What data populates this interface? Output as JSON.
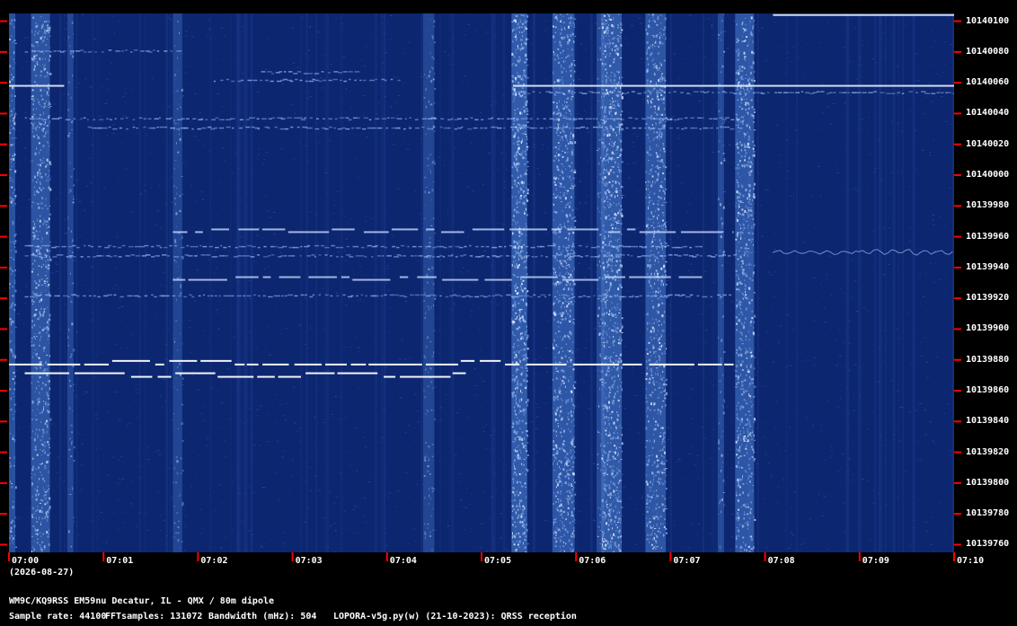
{
  "chart_data": {
    "type": "heatmap",
    "title": "",
    "x_ticks": [
      "07:00",
      "07:01",
      "07:02",
      "07:03",
      "07:04",
      "07:05",
      "07:06",
      "07:07",
      "07:08",
      "07:09",
      "07:10"
    ],
    "x_range": [
      "07:00",
      "07:10"
    ],
    "y_ticks": [
      10140100,
      10140080,
      10140060,
      10140040,
      10140020,
      10140000,
      10139980,
      10139960,
      10139940,
      10139920,
      10139900,
      10139880,
      10139860,
      10139840,
      10139820,
      10139800,
      10139780,
      10139760
    ],
    "y_range": [
      10139755,
      10140105
    ],
    "colors": {
      "background": "#000000",
      "waterfall": "#0c2670",
      "tick": "#ff0000",
      "trace": "#ffffff"
    },
    "noise_columns": [
      {
        "start": "07:00:00",
        "end": "07:00:04",
        "intensity": 0.6
      },
      {
        "start": "07:00:14",
        "end": "07:00:26",
        "intensity": 0.7
      },
      {
        "start": "07:00:37",
        "end": "07:00:41",
        "intensity": 0.25
      },
      {
        "start": "07:01:44",
        "end": "07:01:50",
        "intensity": 0.2
      },
      {
        "start": "07:04:23",
        "end": "07:04:30",
        "intensity": 0.25
      },
      {
        "start": "07:05:19",
        "end": "07:05:29",
        "intensity": 0.95
      },
      {
        "start": "07:05:45",
        "end": "07:05:59",
        "intensity": 0.8
      },
      {
        "start": "07:06:13",
        "end": "07:06:18",
        "intensity": 0.35
      },
      {
        "start": "07:06:16",
        "end": "07:06:29",
        "intensity": 0.9
      },
      {
        "start": "07:06:44",
        "end": "07:06:57",
        "intensity": 0.75
      },
      {
        "start": "07:07:30",
        "end": "07:07:34",
        "intensity": 0.25
      },
      {
        "start": "07:07:41",
        "end": "07:07:53",
        "intensity": 0.8
      }
    ],
    "traces": [
      {
        "start": "07:00:00",
        "end": "07:07:40",
        "freq": 10139877,
        "style": "bright-dashed"
      },
      {
        "start": "07:00:10",
        "end": "07:04:50",
        "freq": 10139869,
        "style": "bright-dashed"
      },
      {
        "start": "07:00:00",
        "end": "07:00:35",
        "freq": 10140058,
        "style": "bright"
      },
      {
        "start": "07:05:20",
        "end": "07:10:00",
        "freq": 10140058,
        "style": "bright"
      },
      {
        "start": "07:05:20",
        "end": "07:10:00",
        "freq": 10140054,
        "style": "faint"
      },
      {
        "start": "07:01:44",
        "end": "07:07:40",
        "freq": 10139963,
        "style": "dashed"
      },
      {
        "start": "07:00:10",
        "end": "07:07:20",
        "freq": 10139954,
        "style": "faint"
      },
      {
        "start": "07:00:10",
        "end": "07:07:40",
        "freq": 10139948,
        "style": "faint"
      },
      {
        "start": "07:01:44",
        "end": "07:07:20",
        "freq": 10139932,
        "style": "dashed"
      },
      {
        "start": "07:00:10",
        "end": "07:07:40",
        "freq": 10140037,
        "style": "faint"
      },
      {
        "start": "07:00:50",
        "end": "07:07:40",
        "freq": 10140031,
        "style": "faint"
      },
      {
        "start": "07:00:10",
        "end": "07:01:50",
        "freq": 10140081,
        "style": "faint"
      },
      {
        "start": "07:02:10",
        "end": "07:04:10",
        "freq": 10140062,
        "style": "faint"
      },
      {
        "start": "07:02:40",
        "end": "07:03:40",
        "freq": 10140067,
        "style": "faint"
      },
      {
        "start": "07:08:05",
        "end": "07:10:00",
        "freq": 10139950,
        "style": "wobble"
      },
      {
        "start": "07:08:05",
        "end": "07:10:00",
        "freq": 10140104,
        "style": "bright"
      },
      {
        "start": "07:00:10",
        "end": "07:07:40",
        "freq": 10139922,
        "style": "faint"
      }
    ]
  },
  "labels": {
    "date": "(2026-08-27)",
    "station": "WM9C/KQ9RSS EM59nu Decatur, IL - QMX / 80m dipole",
    "sample_rate": "Sample rate: 44100",
    "fft_samples": "FFTsamples: 131072",
    "bandwidth": "Bandwidth (mHz): 504",
    "software": "LOPORA-v5g.py(w) (21-10-2023): QRSS reception"
  }
}
